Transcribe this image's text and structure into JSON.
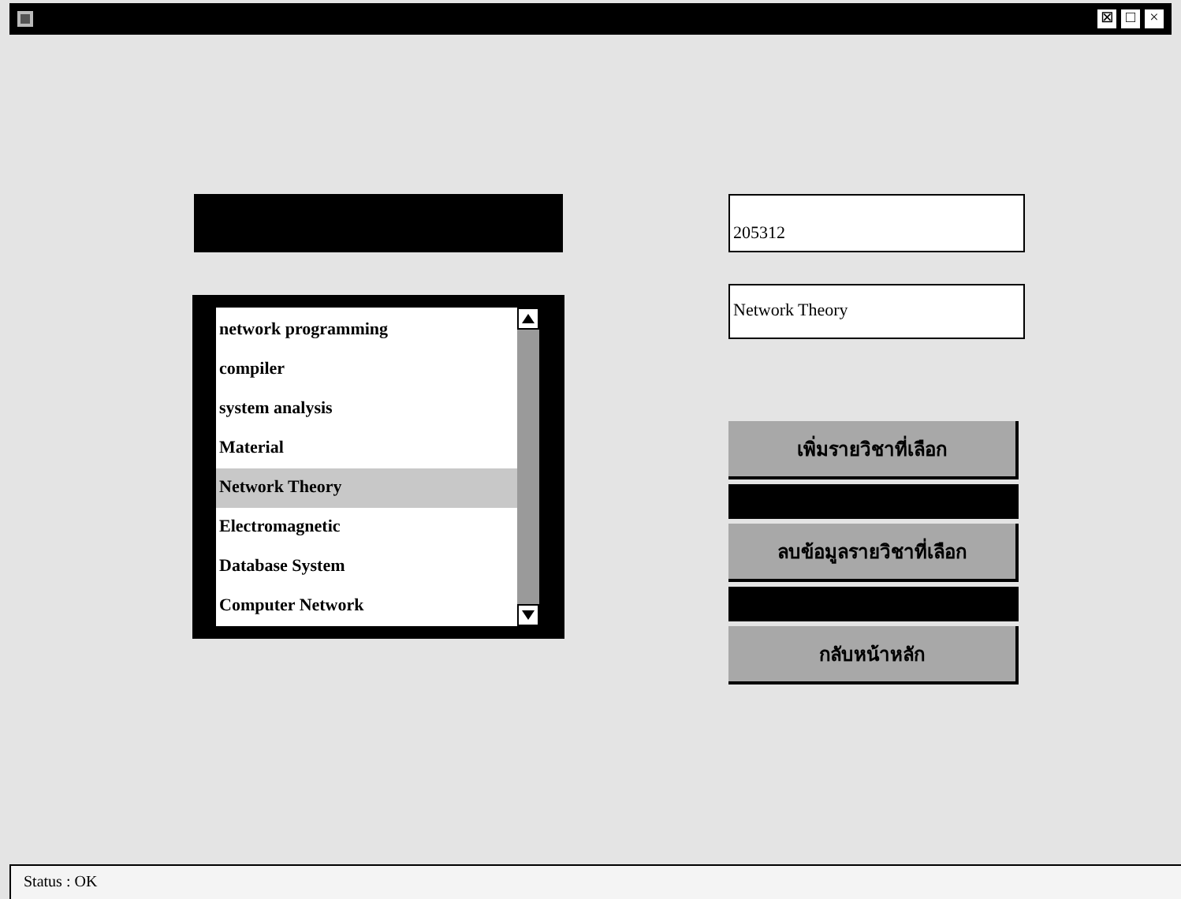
{
  "window": {
    "controls": [
      "⊠",
      "□",
      "×"
    ]
  },
  "subjects": [
    {
      "label": "network programming",
      "selected": false
    },
    {
      "label": "compiler",
      "selected": false
    },
    {
      "label": "system analysis",
      "selected": false
    },
    {
      "label": "Material",
      "selected": false
    },
    {
      "label": "Network Theory",
      "selected": true
    },
    {
      "label": "Electromagnetic",
      "selected": false
    },
    {
      "label": "Database System",
      "selected": false
    },
    {
      "label": "Computer Network",
      "selected": false
    }
  ],
  "code_field": {
    "value": "205312"
  },
  "name_field": {
    "value": "Network Theory"
  },
  "buttons": [
    "เพิ่มรายวิชาที่เลือก",
    "ลบข้อมูลรายวิชาที่เลือก",
    "กลับหน้าหลัก"
  ],
  "status_bar": "Status : OK"
}
